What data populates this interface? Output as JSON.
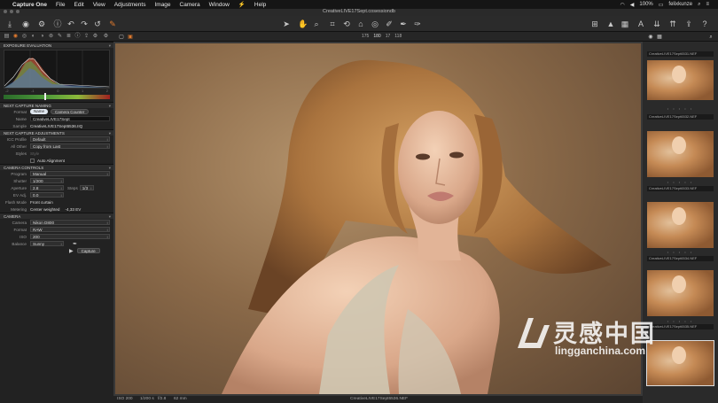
{
  "menubar": {
    "app": "Capture One",
    "items": [
      "File",
      "Edit",
      "View",
      "Adjustments",
      "Image",
      "Camera",
      "Window",
      "Help"
    ],
    "battery": "100%",
    "user": "felixkunze"
  },
  "window": {
    "title": "CreativeLIVE17Sept.cosessiondb"
  },
  "viewer_bar": {
    "nums": [
      "175",
      "180",
      "17",
      "118"
    ]
  },
  "left": {
    "exposure": {
      "title": "EXPOSURE EVALUATION",
      "ticks": [
        "-2",
        "-1",
        "0",
        "1",
        "2"
      ]
    },
    "naming": {
      "title": "NEXT CAPTURE NAMING",
      "format_label": "Format",
      "format_on": "Name",
      "format_off": "Camera Counter",
      "name_label": "Name",
      "name_value": "CreativeLIVE17Sept",
      "sample_label": "Sample",
      "sample_value": "CreativeLIVE17Sept6536.IIQ"
    },
    "adjustments": {
      "title": "NEXT CAPTURE ADJUSTMENTS",
      "icc_label": "ICC Profile",
      "icc_value": "Default",
      "other_label": "All Other",
      "other_value": "Copy from Last",
      "styles_label": "Styles",
      "styles_value": "Style",
      "auto_align": "Auto Alignment"
    },
    "camera_controls": {
      "title": "CAMERA CONTROLS",
      "program_label": "Program",
      "program_value": "Manual",
      "shutter_label": "Shutter",
      "shutter_value": "1/200",
      "aperture_label": "Aperture",
      "aperture_value": "2.8",
      "steps_label": "Steps",
      "steps_value": "1/3",
      "ev_label": "EV Adj.",
      "ev_value": "0.0",
      "flash_label": "Flash Mode",
      "flash_value": "Front curtain",
      "metering_label": "Metering",
      "metering_value": "Center weighted",
      "metering_ev": "-4,33 EV"
    },
    "camera": {
      "title": "CAMERA",
      "camera_label": "Camera",
      "camera_value": "Nikon D800",
      "format_label": "Format",
      "format_value": "RAW",
      "iso_label": "ISO",
      "iso_value": "200",
      "balance_label": "Balance",
      "balance_value": "Sunny",
      "capture_btn": "Capture"
    }
  },
  "viewer_status": {
    "iso": "ISO 200",
    "shutter": "1/200 s",
    "aperture": "f/2.8",
    "focal": "62 mm",
    "filename": "CreativeLIVE17Sept6536.NEF"
  },
  "browser": {
    "thumbs": [
      "CreativeLIVE17Sept6531.NEF",
      "CreativeLIVE17Sept6532.NEF",
      "CreativeLIVE17Sept6533.NEF",
      "CreativeLIVE17Sept6534.NEF",
      "CreativeLIVE17Sept6535.NEF"
    ],
    "stars": "• • • • •"
  },
  "watermark": {
    "cn": "灵感中国",
    "url": "lingganchina.com"
  },
  "colors": {
    "accent": "#e07a2e",
    "panel": "#222222",
    "viewer": "#383838"
  }
}
